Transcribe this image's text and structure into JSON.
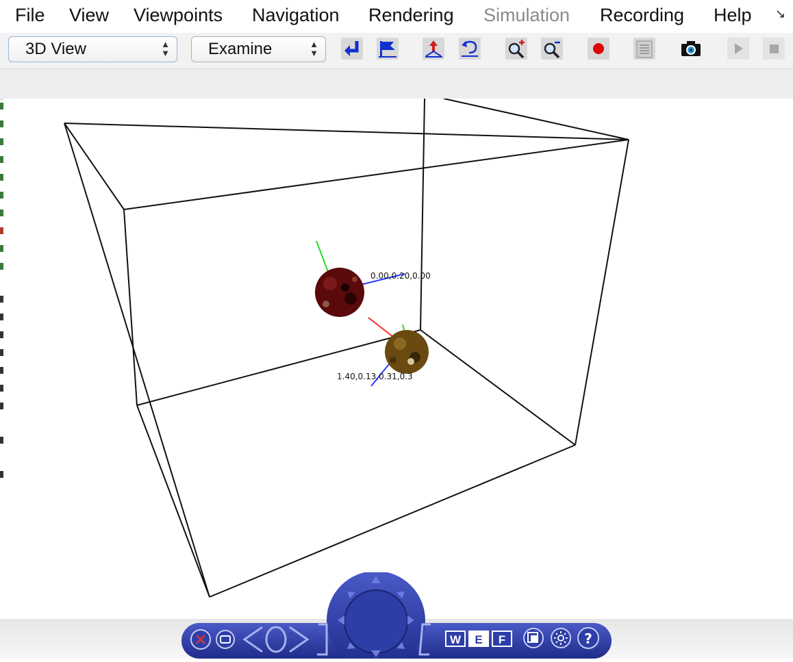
{
  "menubar": {
    "items": [
      "File",
      "View",
      "Viewpoints",
      "Navigation",
      "Rendering",
      "Simulation",
      "Recording",
      "Help"
    ],
    "disabled_item": "Simulation",
    "overflow_glyph": "↘"
  },
  "toolbar": {
    "view_select": {
      "value": "3D View"
    },
    "nav_mode_select": {
      "value": "Examine"
    },
    "buttons": [
      {
        "icon": "return-arrow-icon"
      },
      {
        "icon": "flag-icon"
      },
      {
        "icon": "align-up-icon"
      },
      {
        "icon": "undo-icon"
      },
      {
        "icon": "zoom-in-icon"
      },
      {
        "icon": "zoom-out-icon"
      },
      {
        "icon": "record-icon",
        "color": "#e00000"
      },
      {
        "icon": "clipboard-icon"
      },
      {
        "icon": "camera-icon"
      },
      {
        "icon": "play-icon",
        "state": "disabled"
      },
      {
        "icon": "stop-icon",
        "state": "disabled"
      }
    ]
  },
  "scene": {
    "objects": [
      {
        "name": "dark red spherical object",
        "label": "0.00,0.20,0.00",
        "color": "#5a0a0a"
      },
      {
        "name": "golden brown spherical object",
        "label": "1.40,0.13,0.31,0.3",
        "color": "#6b4a12"
      }
    ],
    "axis_colors": {
      "x": "#ff2a2a",
      "y": "#22dd22",
      "z": "#2a3aff"
    },
    "box_color": "#111111"
  },
  "nav_widget": {
    "color": "#2d3ea8",
    "buttons": {
      "close": "close-icon",
      "restore": "restore-icon",
      "wireframe": "W",
      "examine": "E",
      "fly": "F",
      "fit": "fit-view-icon",
      "headlight": "headlight-icon",
      "help": "?"
    }
  }
}
